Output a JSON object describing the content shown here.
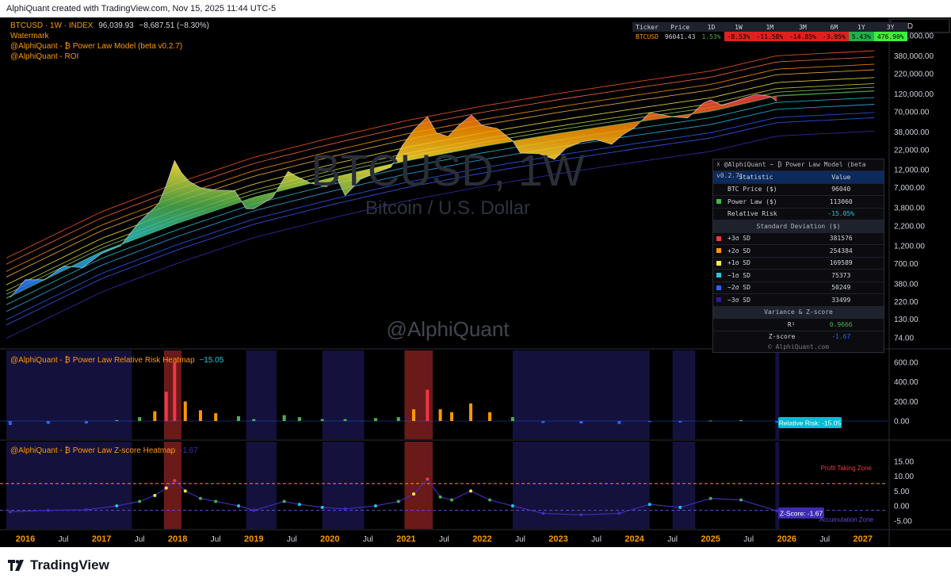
{
  "header": {
    "attribution": "AlphiQuant created with TradingView.com, Nov 15, 2025 11:44 UTC-5"
  },
  "main_legend": {
    "symbol_line": "BTCUSD · 1W · INDEX",
    "price": "96,039.93",
    "change": "−8,687.51 (−8.30%)",
    "line2": "Watermark",
    "line3": "@AlphiQuant - ₿ Power Law Model (beta v0.2.7)",
    "line4": "@AlphiQuant - ROI"
  },
  "watermark": {
    "big": "BTCUSD, 1W",
    "sub": "Bitcoin / U.S. Dollar",
    "handle": "@AlphiQuant"
  },
  "currency_label": "USD",
  "performance_table": {
    "headers": [
      "Ticker",
      "Price",
      "1D",
      "1W",
      "1M",
      "3M",
      "6M",
      "1Y",
      "3Y"
    ],
    "row": [
      "BTCUSD",
      "96041.43",
      "1.53%",
      "-8.53%",
      "-11.58%",
      "-14.85%",
      "-3.95%",
      "5.43%",
      "476.90%"
    ],
    "colors": [
      "#000000",
      "#000000",
      "#000000",
      "#e0201f",
      "#e0201f",
      "#e0201f",
      "#e0201f",
      "#22b14c",
      "#3cf03c"
    ]
  },
  "stats_table": {
    "title": "☓ @AlphiQuant − ₿ Power Law Model (beta v0.2.7)",
    "col_headers": [
      "Statistic",
      "Value"
    ],
    "rows": [
      {
        "label": "BTC Price ($)",
        "value": "96040",
        "swatch": ""
      },
      {
        "label": "Power Law ($)",
        "value": "113060",
        "swatch": "#3fb950"
      },
      {
        "label": "Relative Risk",
        "value": "-15.05%",
        "swatch": ""
      }
    ],
    "sd_header": "Standard Deviation ($)",
    "sd_rows": [
      {
        "label": "+3σ SD",
        "value": "381576",
        "swatch": "#f23645"
      },
      {
        "label": "+2σ SD",
        "value": "254384",
        "swatch": "#ff9800"
      },
      {
        "label": "+1σ SD",
        "value": "169589",
        "swatch": "#ffeb3b"
      },
      {
        "label": "−1σ SD",
        "value": "75373",
        "swatch": "#26c6da"
      },
      {
        "label": "−2σ SD",
        "value": "50249",
        "swatch": "#2962ff"
      },
      {
        "label": "−3σ SD",
        "value": "33499",
        "swatch": "#311b92"
      }
    ],
    "var_header": "Variance & Z-score",
    "r2_label": "R²",
    "r2_value": "0.9666",
    "z_label": "Z-score",
    "z_value": "-1.67",
    "footer": "© AlphiQuant.com"
  },
  "pane2": {
    "title": "@AlphiQuant - ₿ Power Law Relative Risk Heatmap",
    "value": "−15.05",
    "tag": "Relative Risk: -15.05"
  },
  "pane3": {
    "title": "@AlphiQuant - ₿ Power Law Z-score Heatmap",
    "value": "-1.67",
    "tag": "Z-Score: -1.67",
    "profit_zone": "Profit Taking Zone",
    "accum_zone": "Accumulation Zone"
  },
  "footer_logo": "TradingView",
  "colors": {
    "background": "#000000",
    "axis_text": "#d1d4dc",
    "year_label": "#ff9800",
    "rr_tag": "#00bcd4",
    "z_tag": "#3f2bb5"
  },
  "chart_data": [
    {
      "type": "line",
      "name": "price-pane",
      "y_scale": "log",
      "yticks": [
        74,
        130,
        220,
        380,
        700,
        1200,
        2200,
        3800,
        7000,
        12000,
        22000,
        38000,
        70000,
        120000,
        220000,
        380000,
        700000
      ],
      "ytick_labels": [
        "74.00",
        "130.00",
        "220.00",
        "380.00",
        "700.00",
        "1,200.00",
        "2,200.00",
        "3,800.00",
        "7,000.00",
        "12,000.00",
        "22,000.00",
        "38,000.00",
        "70,000.00",
        "120,000.00",
        "220,000.00",
        "380,000.00",
        "700,000.00"
      ],
      "x_labels": [
        "2016",
        "Jul",
        "2017",
        "Jul",
        "2018",
        "Jul",
        "2019",
        "Jul",
        "2020",
        "Jul",
        "2021",
        "Jul",
        "2022",
        "Jul",
        "2023",
        "Jul",
        "2024",
        "Jul",
        "2025",
        "Jul",
        "2026",
        "Jul",
        "2027"
      ],
      "x_label_is_year": [
        true,
        false,
        true,
        false,
        true,
        false,
        true,
        false,
        true,
        false,
        true,
        false,
        true,
        false,
        true,
        false,
        true,
        false,
        true,
        false,
        true,
        false,
        true
      ],
      "x_range": [
        2015.75,
        2027.2
      ],
      "series": [
        {
          "name": "BTCUSD",
          "x": [
            2015.8,
            2016.0,
            2016.25,
            2016.5,
            2016.75,
            2017.0,
            2017.25,
            2017.5,
            2017.75,
            2017.85,
            2017.96,
            2018.05,
            2018.15,
            2018.3,
            2018.5,
            2018.75,
            2018.9,
            2019.0,
            2019.25,
            2019.45,
            2019.55,
            2019.75,
            2019.95,
            2020.1,
            2020.2,
            2020.4,
            2020.6,
            2020.8,
            2020.95,
            2021.1,
            2021.28,
            2021.4,
            2021.55,
            2021.7,
            2021.86,
            2022.0,
            2022.2,
            2022.4,
            2022.5,
            2022.75,
            2022.95,
            2023.1,
            2023.3,
            2023.5,
            2023.7,
            2023.85,
            2024.0,
            2024.2,
            2024.5,
            2024.7,
            2024.9,
            2025.0,
            2025.15,
            2025.3,
            2025.45,
            2025.6,
            2025.78,
            2025.87
          ],
          "values": [
            250,
            430,
            430,
            650,
            620,
            950,
            1200,
            2500,
            4300,
            7500,
            16000,
            11000,
            8500,
            7000,
            6500,
            6400,
            3700,
            3700,
            5200,
            11500,
            10000,
            8000,
            7200,
            9000,
            5500,
            9000,
            11000,
            13000,
            25000,
            40000,
            60000,
            37000,
            33000,
            47000,
            63000,
            46000,
            42000,
            29000,
            20000,
            19500,
            16500,
            23000,
            28000,
            30000,
            26000,
            35000,
            43000,
            68000,
            60000,
            58000,
            90000,
            100000,
            85000,
            95000,
            107000,
            118000,
            112000,
            96040
          ]
        },
        {
          "name": "Power Law",
          "x": [
            2015.8,
            2017.0,
            2018.0,
            2019.0,
            2020.0,
            2021.0,
            2022.0,
            2023.0,
            2024.0,
            2025.0,
            2025.87,
            2027.2
          ],
          "values": [
            260,
            1000,
            2400,
            5200,
            9300,
            15800,
            24500,
            36000,
            51000,
            71000,
            113060,
            132000
          ]
        }
      ],
      "bands_sd": [
        "+3σ",
        "+2σ",
        "+1σ",
        "−1σ",
        "−2σ",
        "−3σ"
      ]
    },
    {
      "type": "bar",
      "name": "relative-risk-heatmap",
      "yticks": [
        0,
        200,
        400,
        600
      ],
      "ytick_labels": [
        "0.00",
        "200.00",
        "400.00",
        "600.00"
      ],
      "x": [
        2015.8,
        2016.3,
        2016.8,
        2017.2,
        2017.5,
        2017.7,
        2017.85,
        2017.96,
        2018.1,
        2018.3,
        2018.5,
        2018.8,
        2019.0,
        2019.4,
        2019.6,
        2019.9,
        2020.2,
        2020.6,
        2020.9,
        2021.1,
        2021.28,
        2021.45,
        2021.6,
        2021.85,
        2022.1,
        2022.4,
        2022.8,
        2023.3,
        2023.8,
        2024.2,
        2024.6,
        2025.0,
        2025.4,
        2025.87
      ],
      "values": [
        -40,
        -30,
        -25,
        10,
        40,
        100,
        300,
        600,
        200,
        110,
        80,
        50,
        20,
        60,
        40,
        20,
        20,
        30,
        40,
        120,
        320,
        120,
        90,
        180,
        90,
        40,
        -20,
        -25,
        -30,
        -10,
        -15,
        5,
        10,
        -15.05
      ],
      "current": -15.05
    },
    {
      "type": "scatter",
      "name": "zscore-heatmap",
      "yticks": [
        -5,
        0,
        5,
        10,
        15
      ],
      "ytick_labels": [
        "-5.00",
        "0.00",
        "5.00",
        "10.00",
        "15.00"
      ],
      "profit_taking_level": 7.5,
      "accumulation_level": -1.5,
      "x": [
        2015.8,
        2016.3,
        2016.8,
        2017.2,
        2017.5,
        2017.7,
        2017.85,
        2017.96,
        2018.1,
        2018.3,
        2018.5,
        2018.8,
        2019.0,
        2019.4,
        2019.6,
        2019.9,
        2020.2,
        2020.6,
        2020.9,
        2021.1,
        2021.28,
        2021.45,
        2021.6,
        2021.85,
        2022.1,
        2022.4,
        2022.8,
        2023.3,
        2023.8,
        2024.2,
        2024.6,
        2025.0,
        2025.4,
        2025.87
      ],
      "values": [
        -2,
        -1.5,
        -1.3,
        0,
        1.5,
        3.5,
        6,
        8.5,
        5,
        2.5,
        1.5,
        0,
        -1.5,
        1.5,
        0.5,
        -0.5,
        -1,
        0,
        1.5,
        4,
        9,
        3,
        2,
        5,
        2,
        0,
        -2.5,
        -3,
        -2.5,
        0.5,
        -0.5,
        2.5,
        2,
        -1.67
      ],
      "current": -1.67
    }
  ]
}
